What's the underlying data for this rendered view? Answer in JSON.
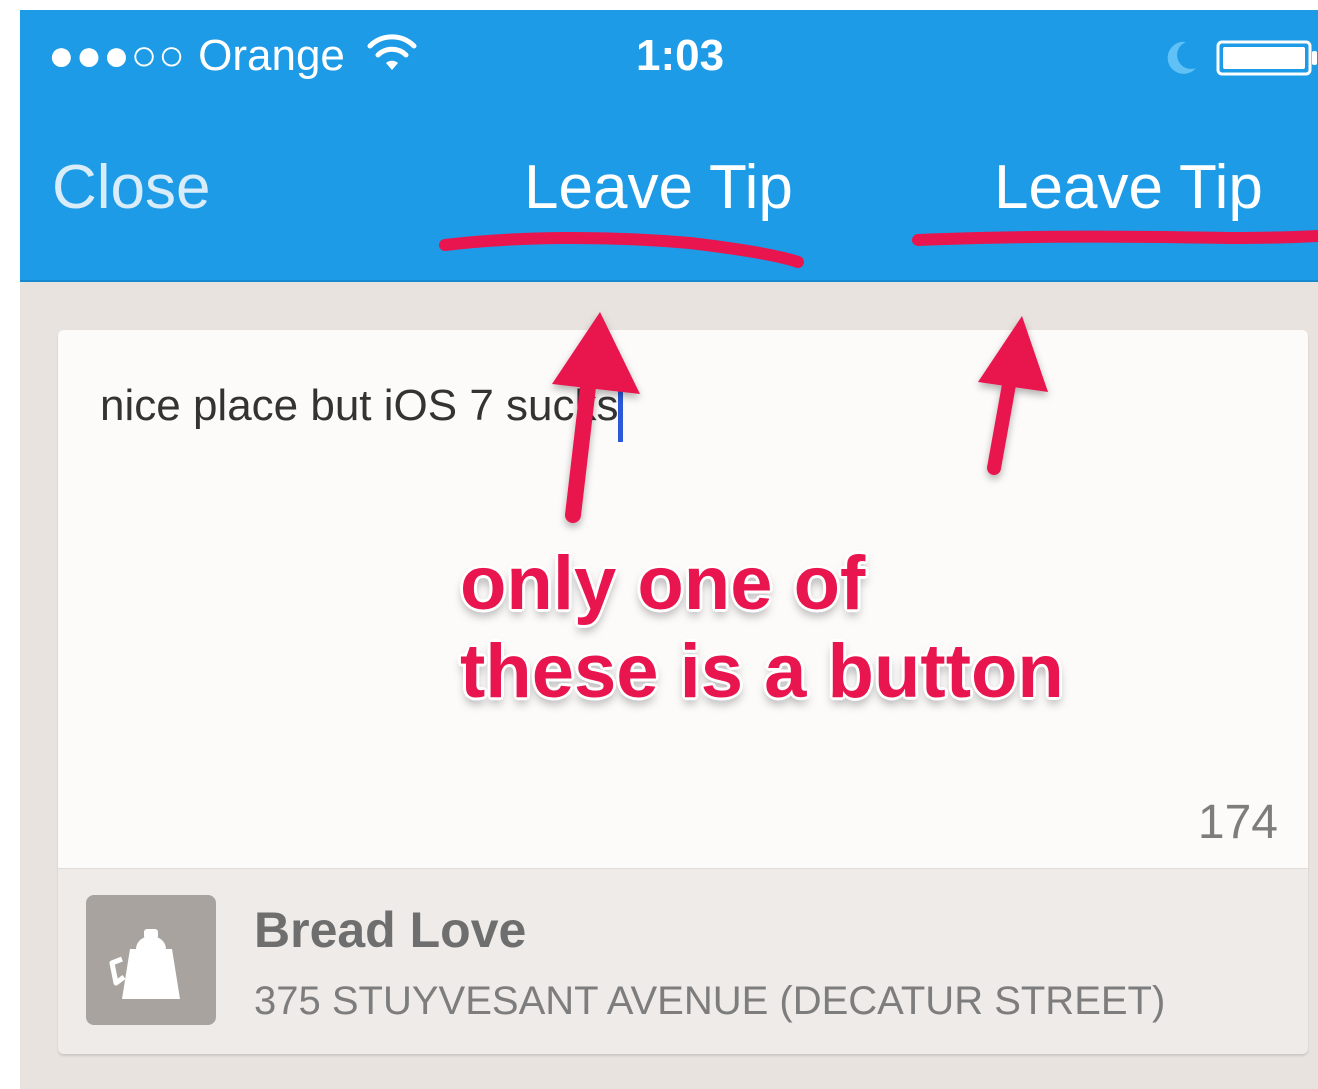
{
  "status_bar": {
    "signal_dots": "●●●○○",
    "carrier": "Orange",
    "wifi_icon": "wifi-icon",
    "time": "1:03",
    "moon_icon": "moon-icon",
    "battery_icon": "battery-icon"
  },
  "nav_bar": {
    "close_label": "Close",
    "title": "Leave Tip",
    "action_label": "Leave Tip"
  },
  "tip_form": {
    "text_value": "nice place but iOS 7 sucks",
    "char_count": "174"
  },
  "venue": {
    "icon": "coffee-pot-icon",
    "name": "Bread Love",
    "address": "375 STUYVESANT AVENUE (DECATUR STREET)"
  },
  "annotation": {
    "line1": "only one of",
    "line2": "these is a button"
  },
  "colors": {
    "nav_blue": "#1e9be6",
    "annotation_red": "#e8154e",
    "page_bg": "#e8e3df",
    "card_bg": "#fcfbfa",
    "cursor_blue": "#2b59d8"
  }
}
